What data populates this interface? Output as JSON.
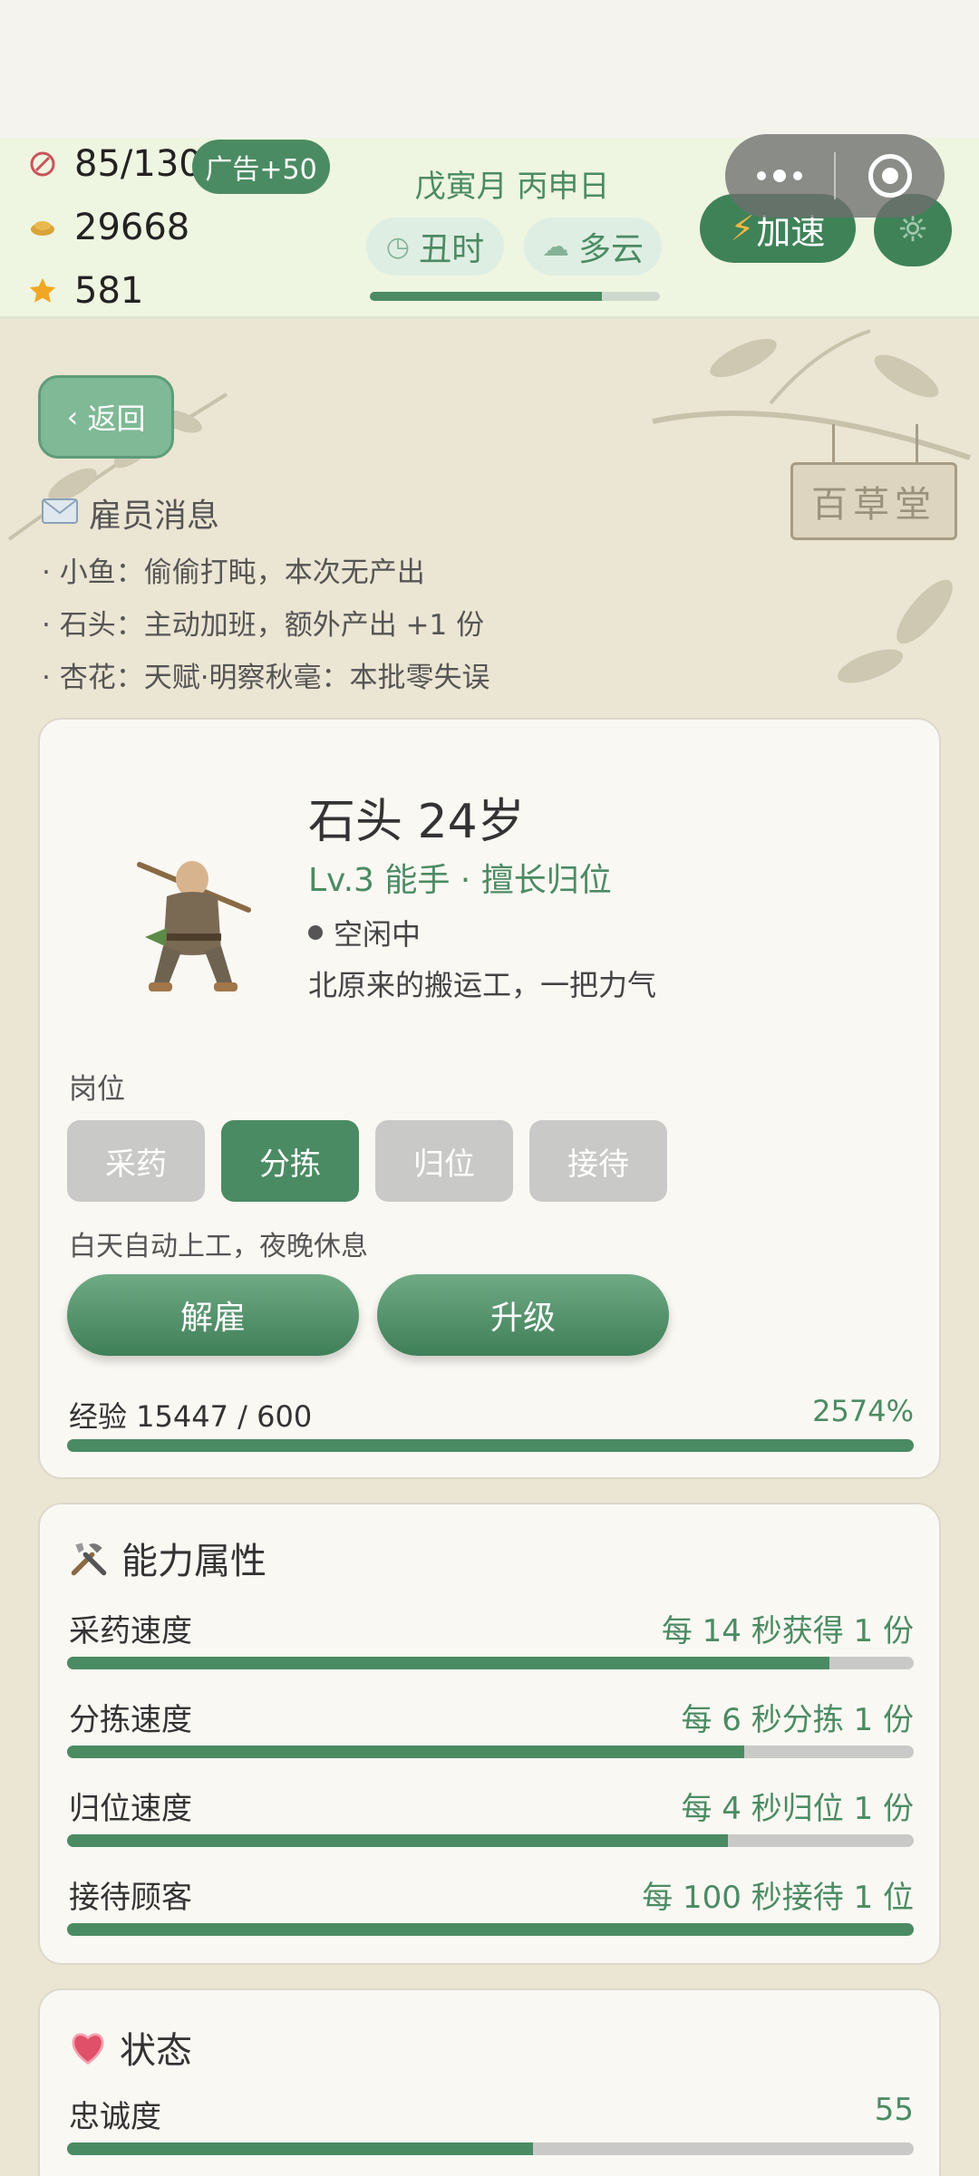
{
  "hud": {
    "energy": "85/130",
    "ad_bonus": "广告+50",
    "coins": "29668",
    "stars": "581",
    "date": "戊寅月 丙申日",
    "time": "丑时",
    "weather": "多云",
    "day_progress": 0.8,
    "speed_label": "加速"
  },
  "back_label": "返回",
  "shop_sign": "百草堂",
  "messages": {
    "title": "雇员消息",
    "lines": [
      "· 小鱼：偷偷打盹，本次无产出",
      "· 石头：主动加班，额外产出 +1 份",
      "· 杏花：天赋·明察秋毫：本批零失误"
    ]
  },
  "employee": {
    "name": "石头  24岁",
    "rank": "Lv.3 能手 · 擅长归位",
    "status": "空闲中",
    "description": "北原来的搬运工，一把力气",
    "posts_label": "岗位",
    "posts": [
      "采药",
      "分拣",
      "归位",
      "接待"
    ],
    "active_post": 1,
    "schedule_hint": "白天自动上工，夜晚休息",
    "fire_label": "解雇",
    "upgrade_label": "升级",
    "exp_label": "经验 15447 / 600",
    "exp_percent": "2574%",
    "exp_fill": 1.0
  },
  "abilities": {
    "title": "能力属性",
    "items": [
      {
        "name": "采药速度",
        "value": "每 14 秒获得 1 份",
        "fill": 0.9
      },
      {
        "name": "分拣速度",
        "value": "每 6 秒分拣 1 份",
        "fill": 0.8
      },
      {
        "name": "归位速度",
        "value": "每 4 秒归位 1 份",
        "fill": 0.78
      },
      {
        "name": "接待顾客",
        "value": "每 100 秒接待 1 位",
        "fill": 1.0
      }
    ]
  },
  "state": {
    "title": "状态",
    "loyalty_label": "忠诚度",
    "loyalty_value": "55",
    "loyalty_fill": 0.55
  },
  "colors": {
    "accent": "#4b8b63",
    "hud_bg": "#eef5e1",
    "inactive_button": "#c9cac7"
  }
}
